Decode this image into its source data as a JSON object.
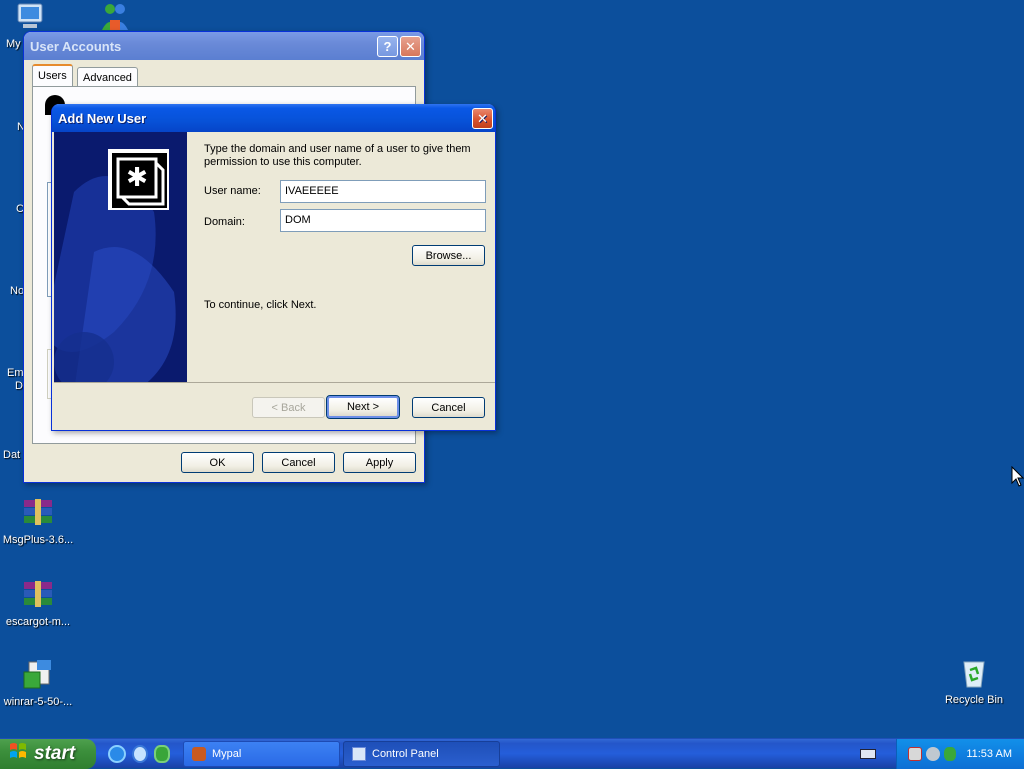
{
  "desktop": {
    "icons": [
      {
        "name": "my-computer",
        "label": "My"
      },
      {
        "name": "msn-messenger",
        "label": ""
      },
      {
        "name": "msgplus",
        "label": "MsgPlus-3.6..."
      },
      {
        "name": "escargot",
        "label": "escargot-m..."
      },
      {
        "name": "winrar",
        "label": "winrar-5-50-..."
      },
      {
        "name": "recycle-bin",
        "label": "Recycle Bin"
      }
    ],
    "clipped_labels": [
      "N",
      "C",
      "No",
      "Em",
      "D",
      "Dat"
    ]
  },
  "user_accounts": {
    "title": "User Accounts",
    "tabs": [
      "Users",
      "Advanced"
    ],
    "buttons": {
      "ok": "OK",
      "cancel": "Cancel",
      "apply": "Apply"
    }
  },
  "add_user": {
    "title": "Add New User",
    "instructions": "Type the domain and user name of a user to give them permission to use this computer.",
    "username_label": "User name:",
    "username_value": "IVAEEEEE",
    "domain_label": "Domain:",
    "domain_value": "DOM",
    "browse": "Browse...",
    "continue_text": "To continue, click Next.",
    "back": "< Back",
    "next": "Next >",
    "cancel": "Cancel"
  },
  "taskbar": {
    "start": "start",
    "tasks": [
      "Mypal",
      "Control Panel"
    ],
    "clock": "11:53 AM"
  },
  "colors": {
    "desktop": "#0c4f9c",
    "titlebar_active": "#0752d8",
    "window_face": "#ece9d8",
    "dialog_banner": "#0a1a6e"
  }
}
